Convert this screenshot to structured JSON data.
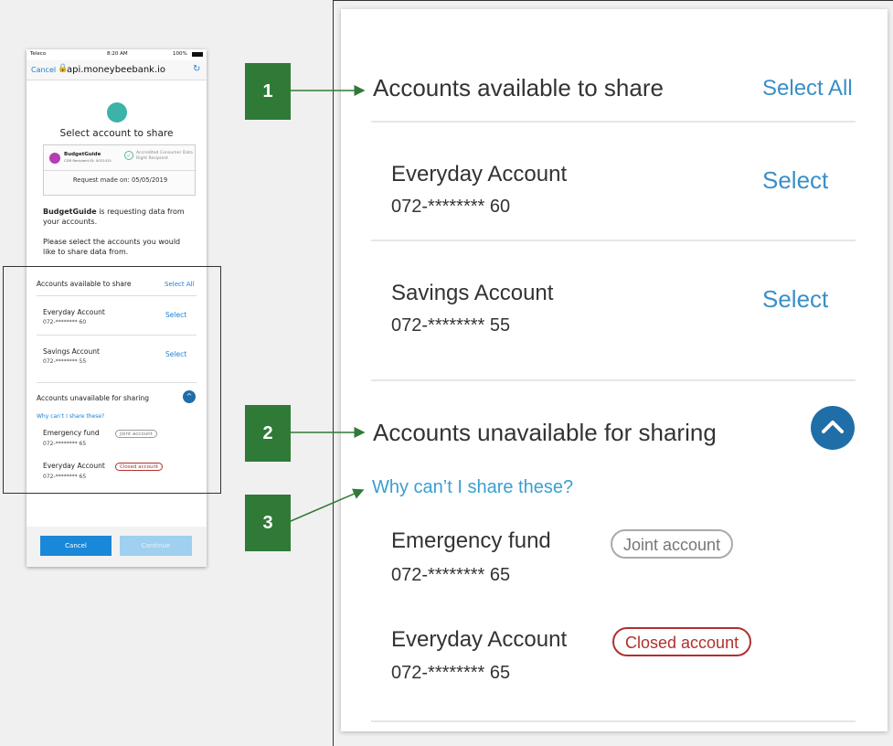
{
  "phone": {
    "status_carrier": "Teleco",
    "status_time": "8:20 AM",
    "status_battery": "100%",
    "cancel": "Cancel",
    "url": "api.moneybeebank.io",
    "title": "Select account to share",
    "recipient_name": "BudgetGuide",
    "recipient_id": "CDR Recipient ID: 0031415",
    "accredited": "Accredited Consumer Data Right Recipient",
    "request_date": "Request made on: 05/05/2019",
    "para1_bold": "BudgetGuide",
    "para1_rest": " is requesting data from your accounts.",
    "para2": "Please select the accounts you would like to share data from.",
    "available_title": "Accounts available to share",
    "select_all": "Select All",
    "accounts": [
      {
        "name": "Everyday Account",
        "number": "072-******** 60",
        "action": "Select"
      },
      {
        "name": "Savings Account",
        "number": "072-******** 55",
        "action": "Select"
      }
    ],
    "unavailable_title": "Accounts unavailable for sharing",
    "why": "Why can’t I share these?",
    "unavailable": [
      {
        "name": "Emergency fund",
        "number": "072-******** 65",
        "badge": "Joint account"
      },
      {
        "name": "Everyday Account",
        "number": "072-******** 65",
        "badge": "Closed account"
      }
    ],
    "btn_cancel": "Cancel",
    "btn_continue": "Continue"
  },
  "callouts": [
    "1",
    "2",
    "3"
  ],
  "zoom": {
    "available_title": "Accounts available to share",
    "select_all": "Select All",
    "accounts": [
      {
        "name": "Everyday Account",
        "number": "072-******** 60",
        "action": "Select"
      },
      {
        "name": "Savings Account",
        "number": "072-******** 55",
        "action": "Select"
      }
    ],
    "unavailable_title": "Accounts unavailable for sharing",
    "why": "Why can’t I share these?",
    "unavailable": [
      {
        "name": "Emergency fund",
        "number": "072-******** 65",
        "badge": "Joint account"
      },
      {
        "name": "Everyday Account",
        "number": "072-******** 65",
        "badge": "Closed account"
      }
    ]
  },
  "colors": {
    "callout": "#2f7a36",
    "link": "#3a8fc7",
    "chevron": "#1f6ea8",
    "closed": "#b03030"
  }
}
